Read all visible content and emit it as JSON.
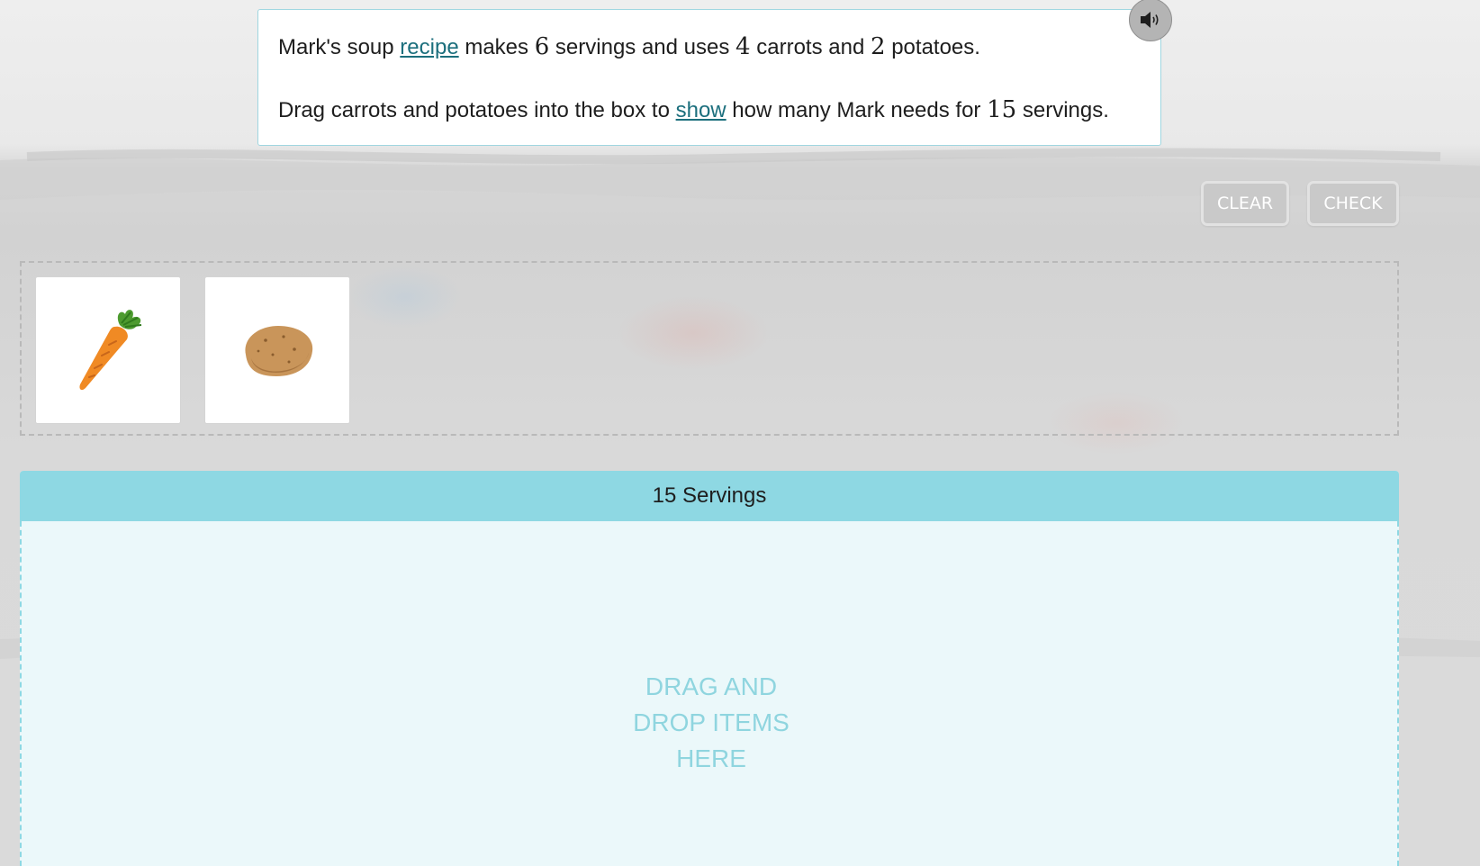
{
  "question": {
    "line1": {
      "before_link": "Mark's soup ",
      "link": "recipe",
      "after_link": " makes ",
      "num_servings": "6",
      "text2": " servings and uses ",
      "num_carrots": "4",
      "text3": " carrots and ",
      "num_potatoes": "2",
      "text4": " potatoes."
    },
    "line2": {
      "before_link": "Drag carrots and potatoes into the box to ",
      "link": "show",
      "after_link": " how many Mark needs for ",
      "num_target": "15",
      "text2": " servings."
    }
  },
  "audio": {
    "icon": "speaker-icon"
  },
  "actions": {
    "clear_label": "CLEAR",
    "check_label": "CHECK"
  },
  "tray": {
    "items": [
      {
        "name": "carrot",
        "icon": "carrot-icon"
      },
      {
        "name": "potato",
        "icon": "potato-icon"
      }
    ]
  },
  "drop_zone": {
    "title": "15 Servings",
    "hint": "DRAG AND\nDROP ITEMS\nHERE"
  },
  "colors": {
    "drop_header": "#8ed8e3",
    "drop_body": "#ebf8fa",
    "link": "#1c6f7d",
    "button_bg": "#c9c9c9"
  }
}
